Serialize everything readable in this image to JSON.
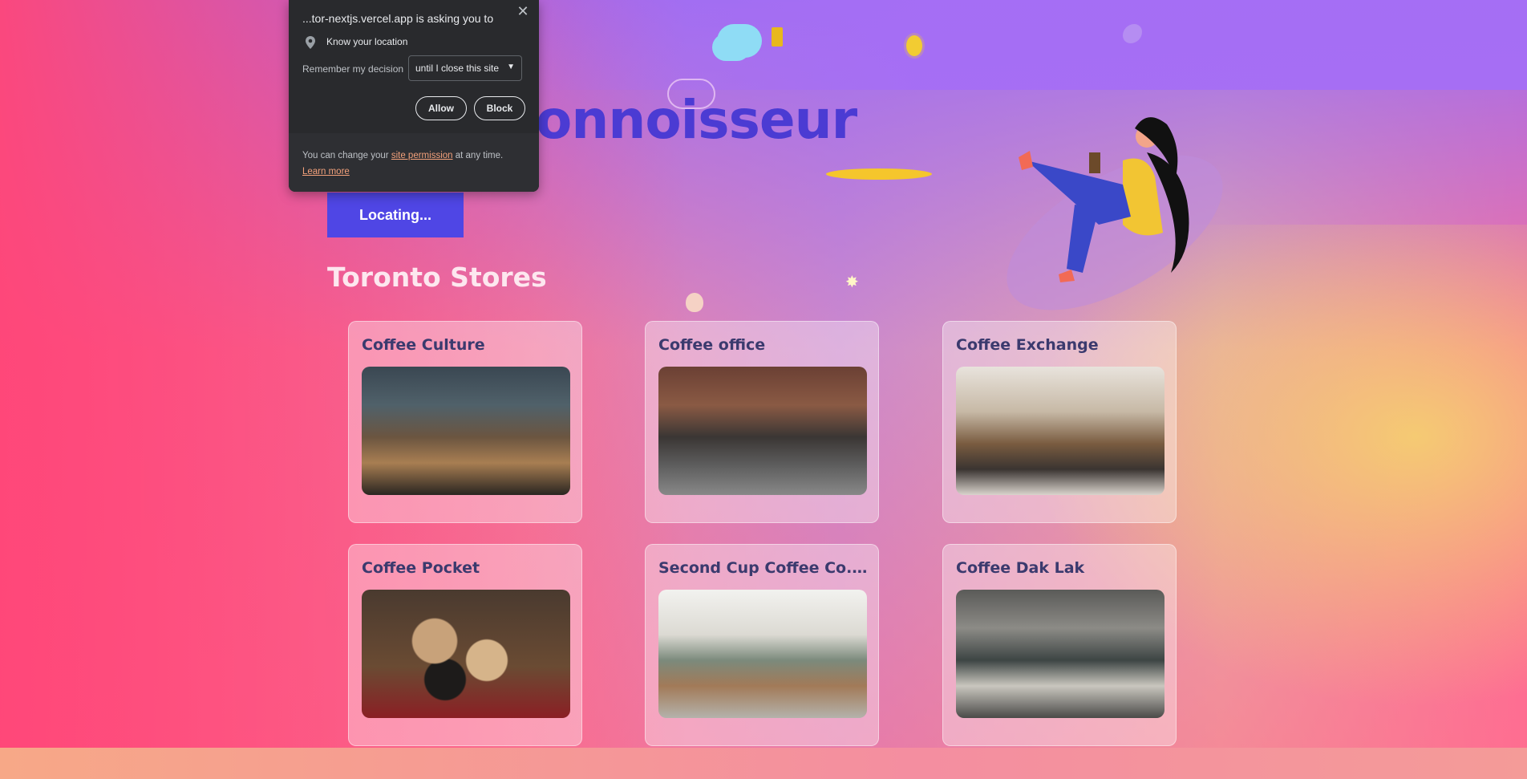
{
  "page": {
    "title": "onnoisseur",
    "locate_button": "Locating...",
    "section_title": "Toronto Stores"
  },
  "stores": [
    {
      "name": "Coffee Culture"
    },
    {
      "name": "Coffee office"
    },
    {
      "name": "Coffee Exchange"
    },
    {
      "name": "Coffee Pocket"
    },
    {
      "name": "Second Cup Coffee Co. fe..."
    },
    {
      "name": "Coffee Dak Lak"
    }
  ],
  "permission_dialog": {
    "title": "...tor-nextjs.vercel.app is asking you to",
    "request": "Know your location",
    "remember_label": "Remember my decision",
    "remember_value": "until I close this site",
    "allow": "Allow",
    "block": "Block",
    "footer_prefix": "You can change your",
    "footer_link": "site permission",
    "footer_suffix": "at any time.",
    "learn_more": "Learn more",
    "icons": [
      "location-pin-icon",
      "close-icon",
      "dropdown-caret-icon"
    ]
  },
  "colors": {
    "accent": "#4f46e5",
    "title": "#4b3bd3",
    "dialog_bg": "#292a2d",
    "link": "#f3a17b"
  }
}
